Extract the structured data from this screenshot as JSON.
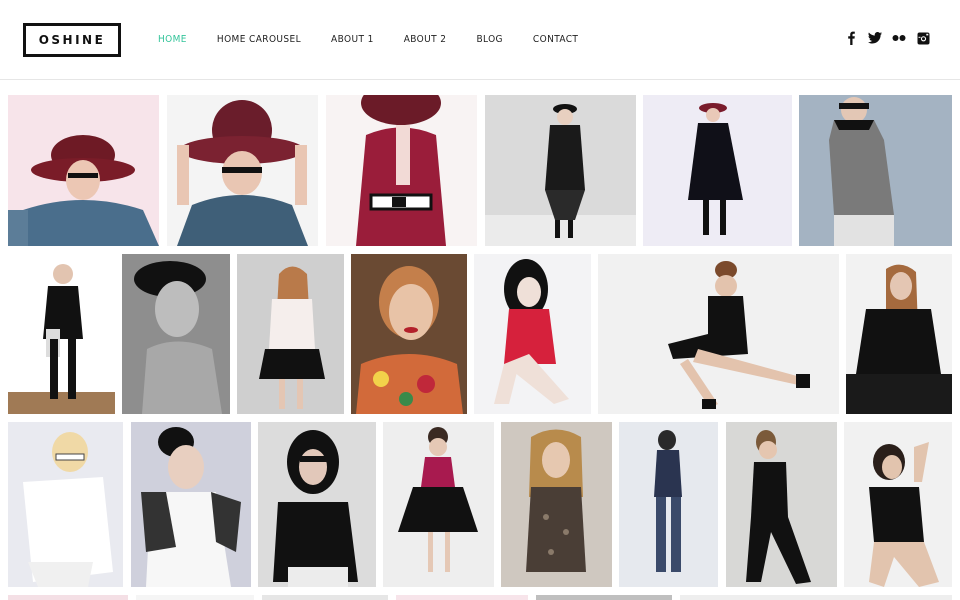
{
  "brand": {
    "logo_text": "OSHINE"
  },
  "nav": {
    "items": [
      {
        "label": "HOME",
        "active": true
      },
      {
        "label": "HOME CAROUSEL",
        "active": false
      },
      {
        "label": "ABOUT 1",
        "active": false
      },
      {
        "label": "ABOUT 2",
        "active": false
      },
      {
        "label": "BLOG",
        "active": false
      },
      {
        "label": "CONTACT",
        "active": false
      }
    ]
  },
  "social": [
    "facebook-icon",
    "twitter-icon",
    "flickr-icon",
    "instagram-icon"
  ],
  "colors": {
    "accent": "#33c49a",
    "text": "#222222",
    "border": "#111111"
  },
  "gallery": {
    "photos": [
      "fashion-photo",
      "fashion-photo",
      "fashion-photo",
      "fashion-photo",
      "fashion-photo",
      "fashion-photo",
      "fashion-photo",
      "fashion-photo",
      "fashion-photo",
      "fashion-photo",
      "fashion-photo",
      "fashion-photo",
      "fashion-photo",
      "fashion-photo",
      "fashion-photo",
      "fashion-photo",
      "fashion-photo",
      "fashion-photo",
      "fashion-photo",
      "fashion-photo",
      "fashion-photo"
    ]
  }
}
